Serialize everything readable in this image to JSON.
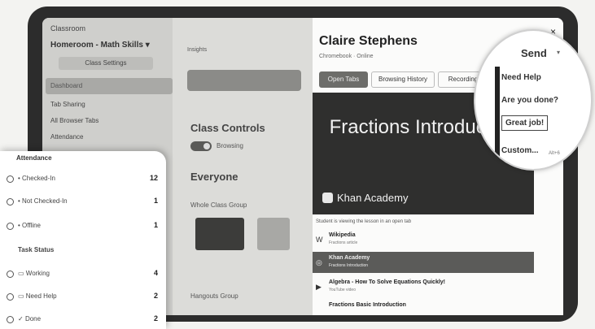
{
  "sidebar": {
    "school_title": "Classroom",
    "class_name": "Homeroom - Math Skills",
    "class_settings": "Class Settings",
    "nav_active": "Dashboard",
    "nav_items": [
      "Tab Sharing",
      "All Browser Tabs",
      "Attendance"
    ]
  },
  "main": {
    "insights": "Insights",
    "class_controls": "Class Controls",
    "browsing": "Browsing",
    "everyone": "Everyone",
    "whole_class_group": "Whole Class Group",
    "hangout_group": "Hangouts Group"
  },
  "student": {
    "name": "Claire Stephens",
    "subtitle": "Chromebook · Online",
    "close": "×",
    "tabs": [
      "Open Tabs",
      "Browsing History",
      "Recording"
    ],
    "hero_title": "Fractions Introduction",
    "hero_brand": "Khan Academy",
    "note": "Student is viewing the lesson in an open tab",
    "list": [
      {
        "icon": "W",
        "title": "Wikipedia",
        "sub": "Fractions article"
      },
      {
        "icon": "◎",
        "title": "Khan Academy",
        "sub": "Fractions Introduction"
      },
      {
        "icon": "▶",
        "title": "Algebra - How To Solve Equations Quickly!",
        "sub": "YouTube video"
      },
      {
        "icon": "",
        "title": "Fractions Basic Introduction",
        "sub": ""
      }
    ]
  },
  "attendance": {
    "heading": "Attendance",
    "rows": [
      {
        "label": "Checked-In",
        "count": "12"
      },
      {
        "label": "Not Checked-In",
        "count": "1"
      },
      {
        "label": "Offline",
        "count": "1"
      }
    ],
    "task_heading": "Task Status",
    "task_rows": [
      {
        "label": "Working",
        "count": "4"
      },
      {
        "label": "Need Help",
        "count": "2"
      },
      {
        "label": "Done",
        "count": "2"
      }
    ]
  },
  "send_menu": {
    "send_label": "Send",
    "items": [
      "Need Help",
      "Are you done?",
      "Great job!",
      "Custom..."
    ],
    "shortcut": "Alt+6"
  }
}
